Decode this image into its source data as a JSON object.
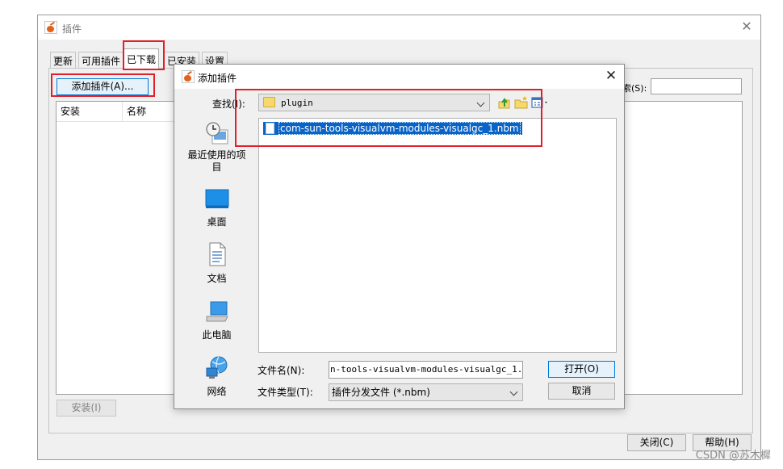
{
  "plugins_window": {
    "title": "插件",
    "tabs": [
      {
        "label": "更新"
      },
      {
        "label": "可用插件"
      },
      {
        "label": "已下载"
      },
      {
        "label": "已安装"
      },
      {
        "label": "设置"
      }
    ],
    "add_plugin_button": "添加插件(A)...",
    "columns": [
      "安装",
      "名称"
    ],
    "search_label": "索(S):",
    "install_button": "安装(I)",
    "close_button": "关闭(C)",
    "help_button": "帮助(H)"
  },
  "dialog": {
    "title": "添加插件",
    "look_in_label": "查找(I):",
    "look_in_value": "plugin",
    "places": [
      {
        "label": "最近使用的项目",
        "icon": "recent-items-icon"
      },
      {
        "label": "桌面",
        "icon": "desktop-icon"
      },
      {
        "label": "文档",
        "icon": "documents-icon"
      },
      {
        "label": "此电脑",
        "icon": "computer-icon"
      },
      {
        "label": "网络",
        "icon": "network-icon"
      }
    ],
    "files": [
      {
        "name": "com-sun-tools-visualvm-modules-visualgc_1.nbm",
        "selected": true
      }
    ],
    "file_name_label": "文件名(N):",
    "file_name_value": "n-tools-visualvm-modules-visualgc_1.nbm",
    "file_type_label": "文件类型(T):",
    "file_type_value": "插件分发文件 (*.nbm)",
    "open_button": "打开(O)",
    "cancel_button": "取消"
  },
  "watermark": "CSDN @苏木樨",
  "colors": {
    "highlight": "#e0202a",
    "selection": "#0a64c8",
    "window_bg": "#f0f0f0",
    "focus_border": "#0078d7"
  }
}
